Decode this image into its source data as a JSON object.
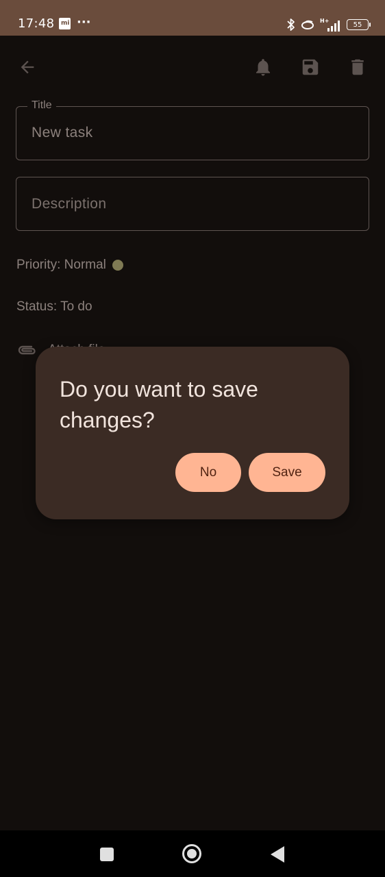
{
  "status_bar": {
    "time": "17:48",
    "network": "H+",
    "battery": "55",
    "more": "···"
  },
  "toolbar": {
    "back_icon": "arrow-back-icon",
    "notify_icon": "bell-icon",
    "save_icon": "floppy-disk-icon",
    "delete_icon": "trash-icon"
  },
  "form": {
    "title_label": "Title",
    "title_value": "New task",
    "description_placeholder": "Description",
    "priority": "Priority: Normal",
    "priority_color": "#7f7a54",
    "status": "Status: To do",
    "attach_label": "Attach file"
  },
  "dialog": {
    "message": "Do you want to save changes?",
    "no_label": "No",
    "save_label": "Save",
    "accent": "#ffb593"
  },
  "nav": {
    "recents_icon": "square-icon",
    "home_icon": "circle-icon",
    "back_icon": "triangle-back-icon"
  }
}
